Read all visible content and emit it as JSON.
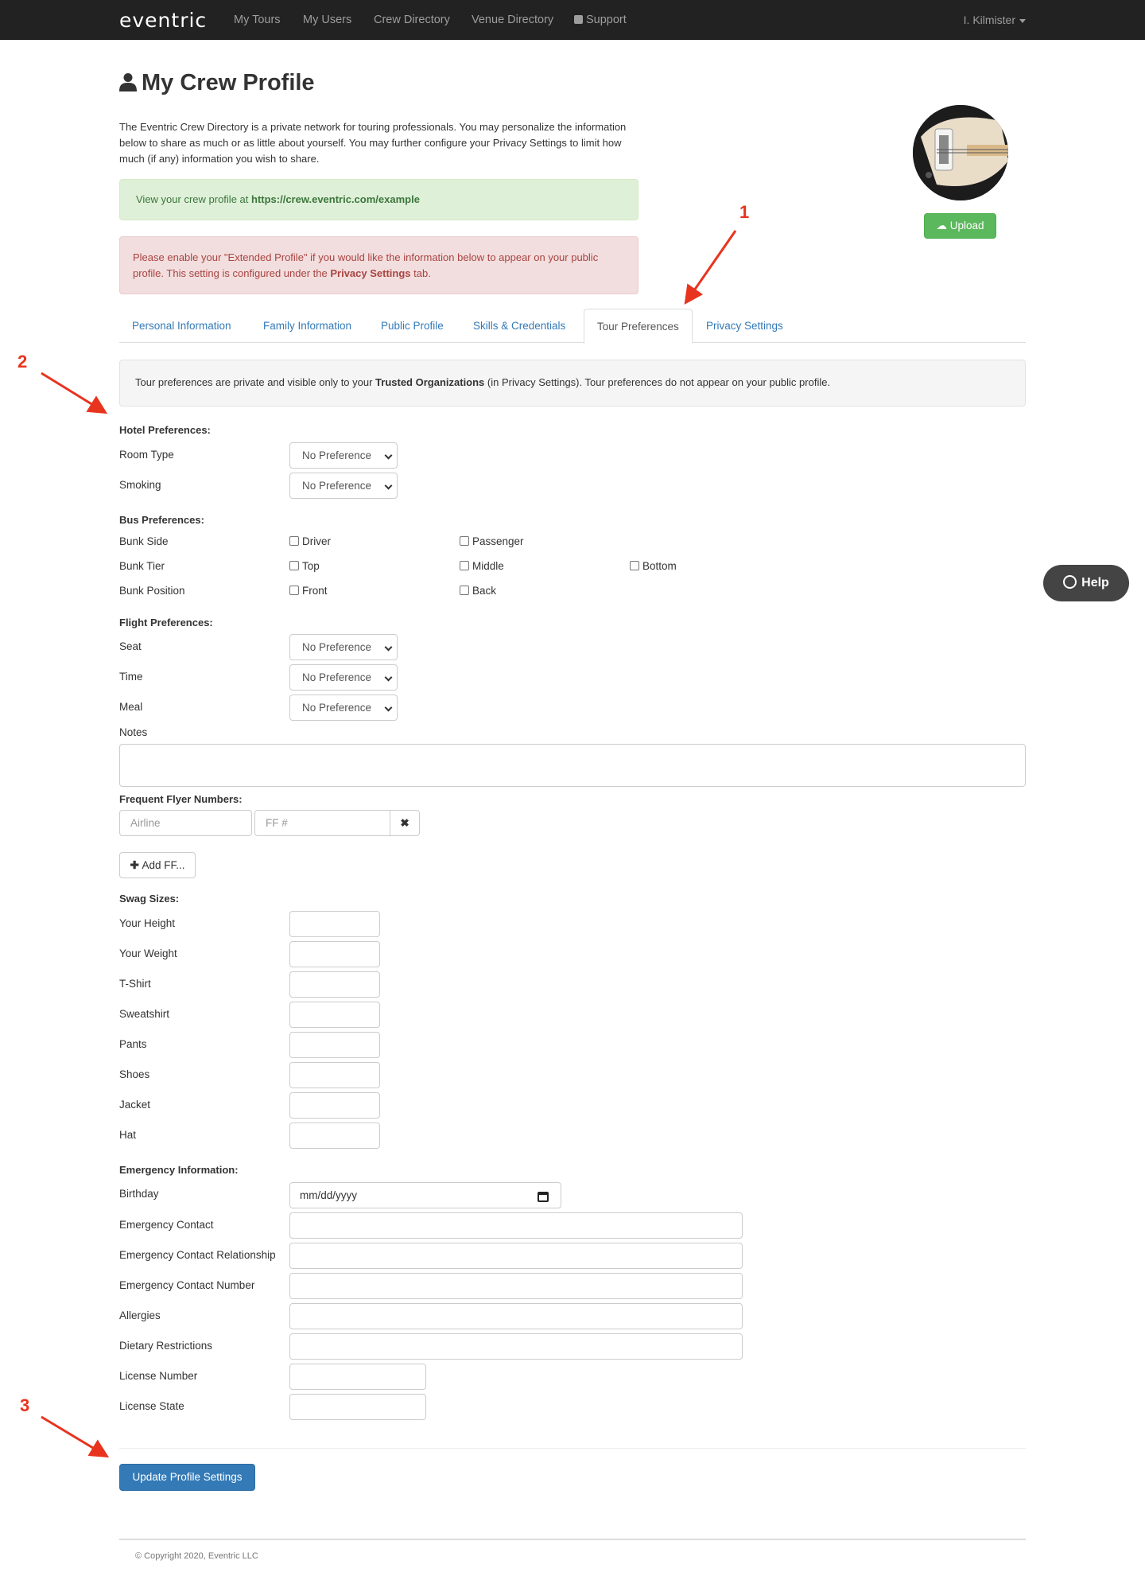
{
  "navbar": {
    "brand": "eventric",
    "items": [
      "My Tours",
      "My Users",
      "Crew Directory",
      "Venue Directory",
      "Support"
    ],
    "user": "I. Kilmister"
  },
  "page": {
    "title": "My Crew Profile",
    "intro": "The Eventric Crew Directory is a private network for touring professionals. You may personalize the information below to share as much or as little about yourself. You may further configure your Privacy Settings to limit how much (if any) information you wish to share."
  },
  "alerts": {
    "success_prefix": "View your crew profile at ",
    "success_link": "https://crew.eventric.com/example",
    "danger_a": "Please enable your \"Extended Profile\" if you would like the information below to appear on your public profile. This setting is configured under the ",
    "danger_bold": "Privacy Settings",
    "danger_b": " tab."
  },
  "avatar": {
    "upload_label": "Upload"
  },
  "tabs": [
    "Personal Information",
    "Family Information",
    "Public Profile",
    "Skills & Credentials",
    "Tour Preferences",
    "Privacy Settings"
  ],
  "active_tab": "Tour Preferences",
  "well": {
    "a": "Tour preferences are private and visible only to your ",
    "bold": "Trusted Organizations",
    "b": " (in Privacy Settings). Tour preferences do not appear on your public profile."
  },
  "hotel": {
    "heading": "Hotel Preferences:",
    "room_type": {
      "label": "Room Type",
      "value": "No Preference"
    },
    "smoking": {
      "label": "Smoking",
      "value": "No Preference"
    }
  },
  "bus": {
    "heading": "Bus Preferences:",
    "bunk_side": {
      "label": "Bunk Side",
      "options": [
        "Driver",
        "Passenger"
      ]
    },
    "bunk_tier": {
      "label": "Bunk Tier",
      "options": [
        "Top",
        "Middle",
        "Bottom"
      ]
    },
    "bunk_position": {
      "label": "Bunk Position",
      "options": [
        "Front",
        "Back"
      ]
    }
  },
  "flight": {
    "heading": "Flight Preferences:",
    "seat": {
      "label": "Seat",
      "value": "No Preference"
    },
    "time": {
      "label": "Time",
      "value": "No Preference"
    },
    "meal": {
      "label": "Meal",
      "value": "No Preference"
    },
    "notes_label": "Notes"
  },
  "frequent_flyer": {
    "heading": "Frequent Flyer Numbers:",
    "airline_placeholder": "Airline",
    "ff_placeholder": "FF #",
    "add_label": "Add FF..."
  },
  "swag": {
    "heading": "Swag Sizes:",
    "fields": [
      "Your Height",
      "Your Weight",
      "T-Shirt",
      "Sweatshirt",
      "Pants",
      "Shoes",
      "Jacket",
      "Hat"
    ]
  },
  "emergency": {
    "heading": "Emergency Information:",
    "birthday_label": "Birthday",
    "birthday_placeholder": "mm/dd/yyyy",
    "fields": [
      "Emergency Contact",
      "Emergency Contact Relationship",
      "Emergency Contact Number",
      "Allergies",
      "Dietary Restrictions",
      "License Number",
      "License State"
    ]
  },
  "submit_label": "Update Profile Settings",
  "footer": "© Copyright 2020, Eventric LLC",
  "help_label": "Help",
  "annotations": [
    "1",
    "2",
    "3"
  ],
  "colors": {
    "navbar": "#222222",
    "link": "#337ab7",
    "success": "#5cb85c",
    "primary": "#337ab7",
    "annotation": "#e8341f"
  }
}
